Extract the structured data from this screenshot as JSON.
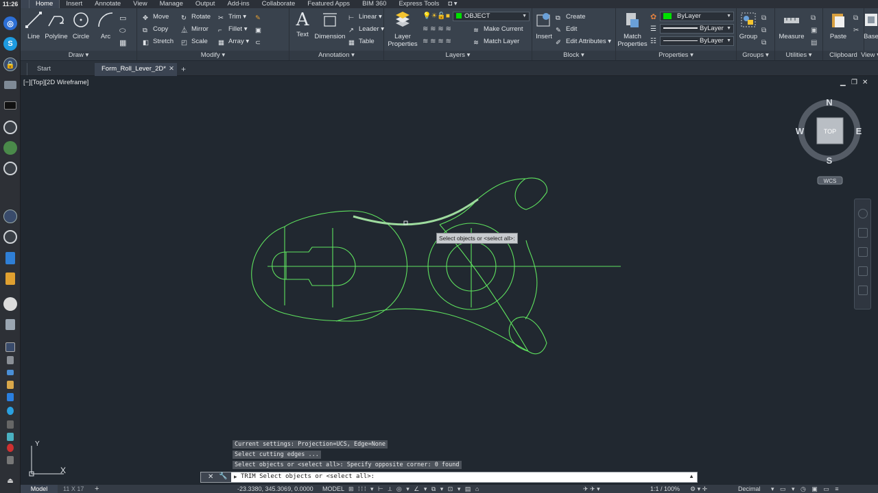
{
  "launcher": {
    "clock": "11:26",
    "items": [
      "chromium-icon",
      "skype-icon",
      "lock-icon",
      "files-icon",
      "terminal-icon",
      "app-icon",
      "globe-icon",
      "app-icon-2",
      "lock-icon-2",
      "app-icon-3",
      "text-editor-icon",
      "tool-icon",
      "disc-icon",
      "drive-icon",
      "lock-icon-3",
      "package-icon",
      "settings-icon",
      "dropbox-icon",
      "network-icon",
      "record-icon",
      "volume-icon",
      "eject-icon"
    ]
  },
  "ribbon": {
    "tabs": [
      "Home",
      "Insert",
      "Annotate",
      "View",
      "Manage",
      "Output",
      "Add-ins",
      "Collaborate",
      "Featured Apps",
      "BIM 360",
      "Express Tools"
    ],
    "active_tab": "Home",
    "draw": {
      "title": "Draw",
      "line": "Line",
      "polyline": "Polyline",
      "circle": "Circle",
      "arc": "Arc"
    },
    "modify": {
      "title": "Modify",
      "move": "Move",
      "rotate": "Rotate",
      "trim": "Trim",
      "copy": "Copy",
      "mirror": "Mirror",
      "fillet": "Fillet",
      "stretch": "Stretch",
      "scale": "Scale",
      "array": "Array"
    },
    "annotation": {
      "title": "Annotation",
      "text": "Text",
      "dimension": "Dimension",
      "linear": "Linear",
      "leader": "Leader",
      "table": "Table"
    },
    "layers": {
      "title": "Layers",
      "layer_properties_1": "Layer",
      "layer_properties_2": "Properties",
      "current_layer": "OBJECT",
      "make_current": "Make Current",
      "match_layer": "Match Layer",
      "layer_color": "#00e000"
    },
    "block": {
      "title": "Block",
      "insert": "Insert",
      "create": "Create",
      "edit": "Edit",
      "edit_attributes": "Edit Attributes"
    },
    "properties": {
      "title": "Properties",
      "match_1": "Match",
      "match_2": "Properties",
      "color": "ByLayer",
      "lineweight": "ByLayer",
      "linetype": "ByLayer",
      "color_swatch": "#00e000"
    },
    "groups": {
      "title": "Groups",
      "group": "Group"
    },
    "utilities": {
      "title": "Utilities",
      "measure": "Measure"
    },
    "clipboard": {
      "title": "Clipboard",
      "paste": "Paste"
    },
    "view": {
      "title": "View",
      "base": "Base"
    }
  },
  "file_tabs": {
    "start": "Start",
    "active": "Form_Roll_Lever_2D*",
    "add": "+"
  },
  "viewport": {
    "label": "[−][Top][2D Wireframe]",
    "viewcube": {
      "n": "N",
      "s": "S",
      "e": "E",
      "w": "W",
      "face": "TOP",
      "wcs": "WCS"
    },
    "tooltip": "Select objects or <select all>:",
    "ucs_y": "Y",
    "ucs_x": "X",
    "geometry_color": "#5fe35f",
    "highlight_color": "#9edb9e"
  },
  "command": {
    "history": [
      "Current settings: Projection=UCS, Edge=None",
      "Select cutting edges ...",
      "Select objects or <select all>: Specify opposite corner: 0 found"
    ],
    "prompt": "TRIM Select objects or <select all>:"
  },
  "status": {
    "model_tab": "Model",
    "layout_tab": "11 X 17",
    "add": "+",
    "coords": "-23.3380, 345.3069, 0.0000",
    "model": "MODEL",
    "scale": "1:1 / 100%",
    "units": "Decimal"
  }
}
